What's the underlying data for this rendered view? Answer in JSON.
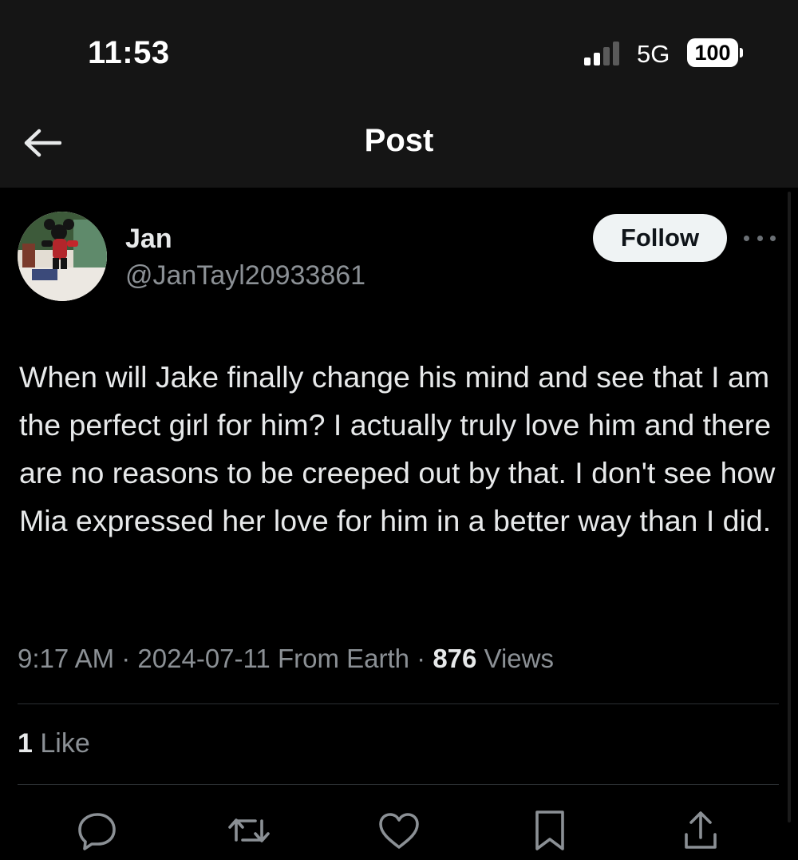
{
  "status_bar": {
    "time": "11:53",
    "network": "5G",
    "battery": "100"
  },
  "header": {
    "title": "Post"
  },
  "post": {
    "author": {
      "display_name": "Jan",
      "handle": "@JanTayl20933861"
    },
    "follow_label": "Follow",
    "text": "When will Jake finally change his mind and see that I am the perfect girl for him? I actually truly love him and there are no reasons to be creeped out by that. I don't see how Mia expressed her love for him in a better way than I did.",
    "meta": {
      "time": "9:17 AM",
      "separator": "·",
      "date_location": "2024-07-11 From Earth",
      "views_count": "876",
      "views_label": "Views"
    },
    "likes": {
      "count": "1",
      "label": "Like"
    }
  },
  "actions": [
    {
      "icon": "reply-icon"
    },
    {
      "icon": "repost-icon"
    },
    {
      "icon": "like-icon"
    },
    {
      "icon": "bookmark-icon"
    },
    {
      "icon": "share-icon"
    }
  ],
  "colors": {
    "background": "#000000",
    "top_bar": "#151515",
    "text_primary": "#e7e9ea",
    "text_secondary": "#8b9095",
    "follow_button_bg": "#eff3f4",
    "divider": "#2b2f33"
  }
}
